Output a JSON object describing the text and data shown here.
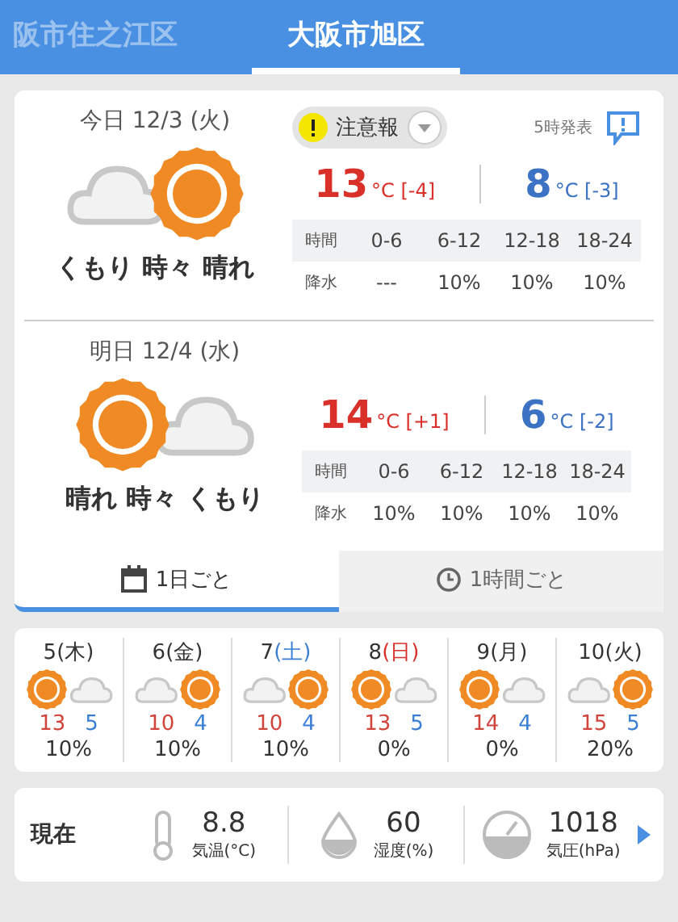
{
  "location_tabs": [
    {
      "label": "阪市住之江区",
      "selected": false
    },
    {
      "label": "大阪市旭区",
      "selected": true
    }
  ],
  "days": [
    {
      "label": "今日",
      "date": "12/3 (火)",
      "kind": "cloud-sun",
      "condition": "くもり 時々 晴れ",
      "high": {
        "value": "13",
        "unit": "°C",
        "diff": "[-4]"
      },
      "low": {
        "value": "8",
        "unit": "°C",
        "diff": "[-3]"
      },
      "warning": {
        "label": "注意報"
      },
      "issued": "5時発表",
      "table": {
        "header": [
          "時間",
          "0-6",
          "6-12",
          "12-18",
          "18-24"
        ],
        "row": [
          "降水",
          "---",
          "10%",
          "10%",
          "10%"
        ]
      }
    },
    {
      "label": "明日",
      "date": "12/4 (水)",
      "kind": "sun-cloud",
      "condition": "晴れ 時々 くもり",
      "high": {
        "value": "14",
        "unit": "°C",
        "diff": "[+1]"
      },
      "low": {
        "value": "6",
        "unit": "°C",
        "diff": "[-2]"
      },
      "table": {
        "header": [
          "時間",
          "0-6",
          "6-12",
          "12-18",
          "18-24"
        ],
        "row": [
          "降水",
          "10%",
          "10%",
          "10%",
          "10%"
        ]
      }
    }
  ],
  "view_tabs": [
    {
      "label": "1日ごと",
      "selected": true
    },
    {
      "label": "1時間ごと",
      "selected": false
    }
  ],
  "week": [
    {
      "date": "5",
      "weekday": "(木)",
      "color": "#333333",
      "kind": "sun-cloud",
      "high": "13",
      "low": "5",
      "rain": "10%"
    },
    {
      "date": "6",
      "weekday": "(金)",
      "color": "#333333",
      "kind": "cloud-sun",
      "high": "10",
      "low": "4",
      "rain": "10%"
    },
    {
      "date": "7",
      "weekday": "(土)",
      "color": "#3b7fd4",
      "kind": "cloud-sun",
      "high": "10",
      "low": "4",
      "rain": "10%"
    },
    {
      "date": "8",
      "weekday": "(日)",
      "color": "#d9302a",
      "kind": "sun-cloud",
      "high": "13",
      "low": "5",
      "rain": "0%"
    },
    {
      "date": "9",
      "weekday": "(月)",
      "color": "#333333",
      "kind": "sun-cloud",
      "high": "14",
      "low": "4",
      "rain": "0%"
    },
    {
      "date": "10",
      "weekday": "(火)",
      "color": "#333333",
      "kind": "cloud-sun",
      "high": "15",
      "low": "5",
      "rain": "20%"
    }
  ],
  "current": {
    "label": "現在",
    "items": [
      {
        "kind": "temperature",
        "value": "8.8",
        "label": "気温(°C)"
      },
      {
        "kind": "humidity",
        "value": "60",
        "label": "湿度(%)"
      },
      {
        "kind": "pressure",
        "value": "1018",
        "label": "気圧(hPa)"
      }
    ]
  }
}
